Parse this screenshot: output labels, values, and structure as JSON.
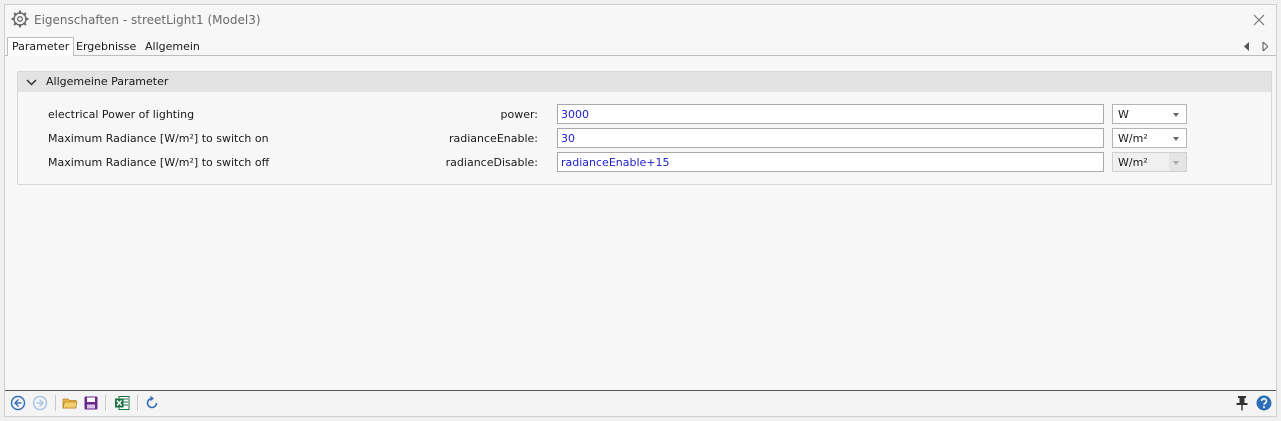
{
  "window": {
    "title": "Eigenschaften - streetLight1 (Model3)"
  },
  "tabs": [
    {
      "label": "Parameter",
      "active": true
    },
    {
      "label": "Ergebnisse",
      "active": false
    },
    {
      "label": "Allgemein",
      "active": false
    }
  ],
  "section": {
    "title": "Allgemeine Parameter",
    "expanded": true
  },
  "params": [
    {
      "description": "electrical Power of lighting",
      "name": "power:",
      "value": "3000",
      "unit": "W",
      "unit_enabled": true
    },
    {
      "description": "Maximum Radiance [W/m²] to switch on",
      "name": "radianceEnable:",
      "value": "30",
      "unit": "W/m²",
      "unit_enabled": true
    },
    {
      "description": "Maximum Radiance [W/m²] to switch off",
      "name": "radianceDisable:",
      "value": "radianceEnable+15",
      "unit": "W/m²",
      "unit_enabled": false
    }
  ],
  "colors": {
    "value_text": "#1f22c7",
    "nav_icon": "#2f6fb7",
    "folder_icon": "#d9a33a",
    "save_icon": "#6a2a8c",
    "excel_icon": "#1e7145",
    "help_icon": "#2f6fb7"
  },
  "statusbar": {
    "icons": [
      "back-icon",
      "forward-icon",
      "open-folder-icon",
      "save-icon",
      "excel-icon",
      "refresh-icon",
      "pin-icon",
      "help-icon"
    ]
  }
}
